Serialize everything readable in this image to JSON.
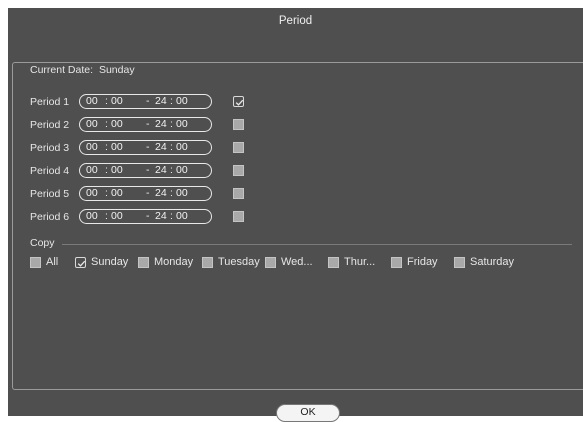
{
  "window": {
    "title": "Period"
  },
  "current_date": {
    "label": "Current Date:",
    "value": "Sunday"
  },
  "periods": [
    {
      "label": "Period 1",
      "start_h": "00",
      "start_m": "00",
      "end_h": "24",
      "end_m": "00",
      "enabled": true
    },
    {
      "label": "Period 2",
      "start_h": "00",
      "start_m": "00",
      "end_h": "24",
      "end_m": "00",
      "enabled": false
    },
    {
      "label": "Period 3",
      "start_h": "00",
      "start_m": "00",
      "end_h": "24",
      "end_m": "00",
      "enabled": false
    },
    {
      "label": "Period 4",
      "start_h": "00",
      "start_m": "00",
      "end_h": "24",
      "end_m": "00",
      "enabled": false
    },
    {
      "label": "Period 5",
      "start_h": "00",
      "start_m": "00",
      "end_h": "24",
      "end_m": "00",
      "enabled": false
    },
    {
      "label": "Period 6",
      "start_h": "00",
      "start_m": "00",
      "end_h": "24",
      "end_m": "00",
      "enabled": false
    }
  ],
  "copy": {
    "label": "Copy",
    "items": [
      {
        "label": "All",
        "checked": false
      },
      {
        "label": "Sunday",
        "checked": true
      },
      {
        "label": "Monday",
        "checked": false
      },
      {
        "label": "Tuesday",
        "checked": false
      },
      {
        "label": "Wed...",
        "checked": false
      },
      {
        "label": "Thur...",
        "checked": false
      },
      {
        "label": "Friday",
        "checked": false
      },
      {
        "label": "Saturday",
        "checked": false
      }
    ]
  },
  "buttons": {
    "ok": "OK"
  }
}
